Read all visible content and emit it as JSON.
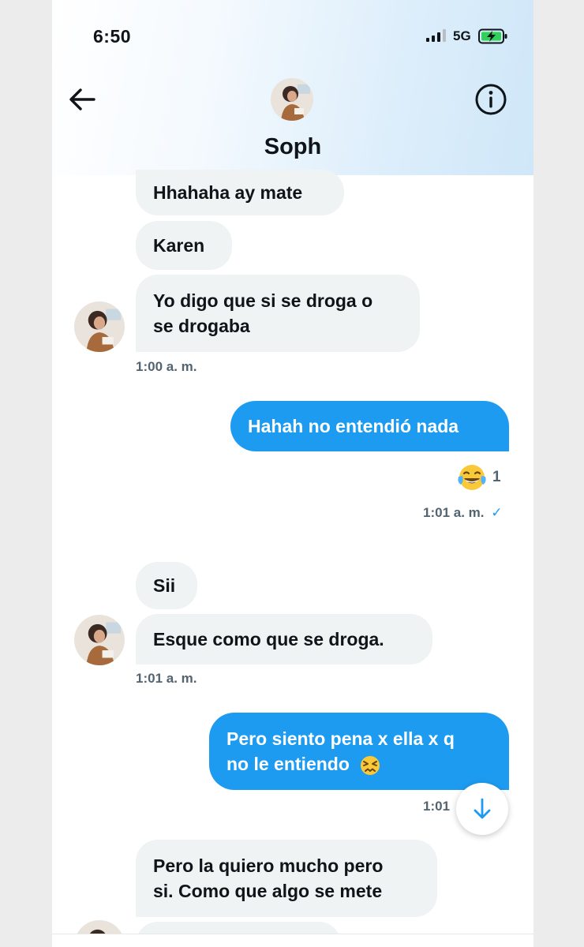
{
  "status_bar": {
    "time": "6:50",
    "network": "5G"
  },
  "header": {
    "contact_name": "Soph"
  },
  "messages": [
    {
      "id": "m1",
      "side": "received",
      "lines": [
        "Hhahaha ay mate"
      ]
    },
    {
      "id": "m2",
      "side": "received",
      "lines": [
        "Karen"
      ]
    },
    {
      "id": "m3",
      "side": "received",
      "lines": [
        "Yo digo que si se droga o",
        "se drogaba"
      ]
    },
    {
      "id": "t1",
      "type": "timestamp",
      "text": "1:00 a. m."
    },
    {
      "id": "m4",
      "side": "sent",
      "lines": [
        "Hahah no entendió nada"
      ]
    },
    {
      "id": "r1",
      "type": "reaction",
      "emoji": "face-with-tears-of-joy",
      "count": "1"
    },
    {
      "id": "t2",
      "type": "timestamp",
      "text": "1:01 a. m.",
      "read_mark": "✓"
    },
    {
      "id": "m5",
      "side": "received",
      "lines": [
        "Sii"
      ]
    },
    {
      "id": "m6",
      "side": "received",
      "lines": [
        "Esque como que se droga."
      ]
    },
    {
      "id": "t3",
      "type": "timestamp",
      "text": "1:01 a. m."
    },
    {
      "id": "m7",
      "side": "sent",
      "lines": [
        "Pero siento pena x ella x q",
        "no le entiendo"
      ],
      "trailing_emoji": "persevering-face"
    },
    {
      "id": "t4",
      "type": "timestamp",
      "text": "1:01"
    },
    {
      "id": "m8",
      "side": "received",
      "lines": [
        "Pero la quiero mucho pero",
        "si. Como que algo se mete"
      ]
    }
  ],
  "icons": {
    "back": "arrow-left-icon",
    "info": "info-icon",
    "scroll_down": "arrow-down-icon",
    "signal": "signal-icon",
    "battery": "battery-charging-icon"
  },
  "colors": {
    "sent_bubble": "#1d9bf0",
    "received_bubble": "#eff3f4",
    "timestamp": "#536471",
    "accent": "#1d9bf0"
  }
}
